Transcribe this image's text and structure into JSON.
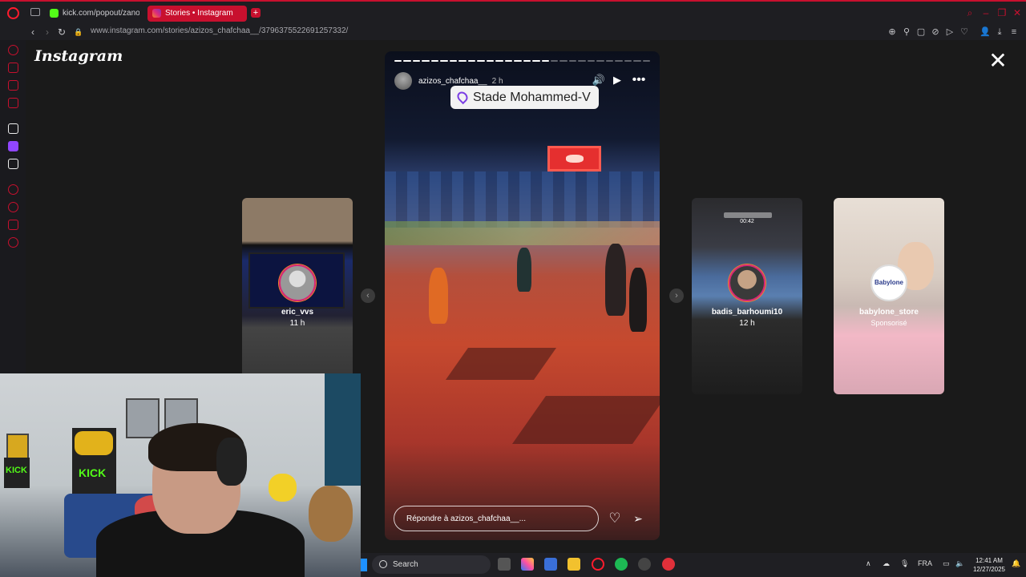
{
  "browser": {
    "tabs": [
      {
        "title": "kick.com/popout/zanoun",
        "active": false
      },
      {
        "title": "Stories • Instagram",
        "active": true
      }
    ],
    "url": "www.instagram.com/stories/azizos_chafchaa__/3796375522691257332/"
  },
  "instagram": {
    "logo": "Instagram",
    "story": {
      "username": "azizos_chafchaa__",
      "time": "2 h",
      "location": "Stade Mohammed-V",
      "reply_placeholder": "Répondre à azizos_chafchaa__...",
      "progress_segments": 28,
      "progress_done": 17
    },
    "side_stories": [
      {
        "username": "eric_vvs",
        "time": "11 h"
      },
      {
        "username": "badis_barhoumi10",
        "time": "12 h",
        "overlay_time": "00:42"
      },
      {
        "username": "babylone_store",
        "time": "Sponsorisé",
        "avatar_text": "Babylone"
      }
    ]
  },
  "webcam": {
    "kick_label": "KICK"
  },
  "taskbar": {
    "search": "Search",
    "language": "FRA",
    "time": "12:41 AM",
    "date": "12/27/2025"
  },
  "colors": {
    "opera_red": "#c8102e",
    "ig_ring_pink": "#d62976",
    "location_pin": "#7b3fe4",
    "kick_green": "#53fc18"
  }
}
